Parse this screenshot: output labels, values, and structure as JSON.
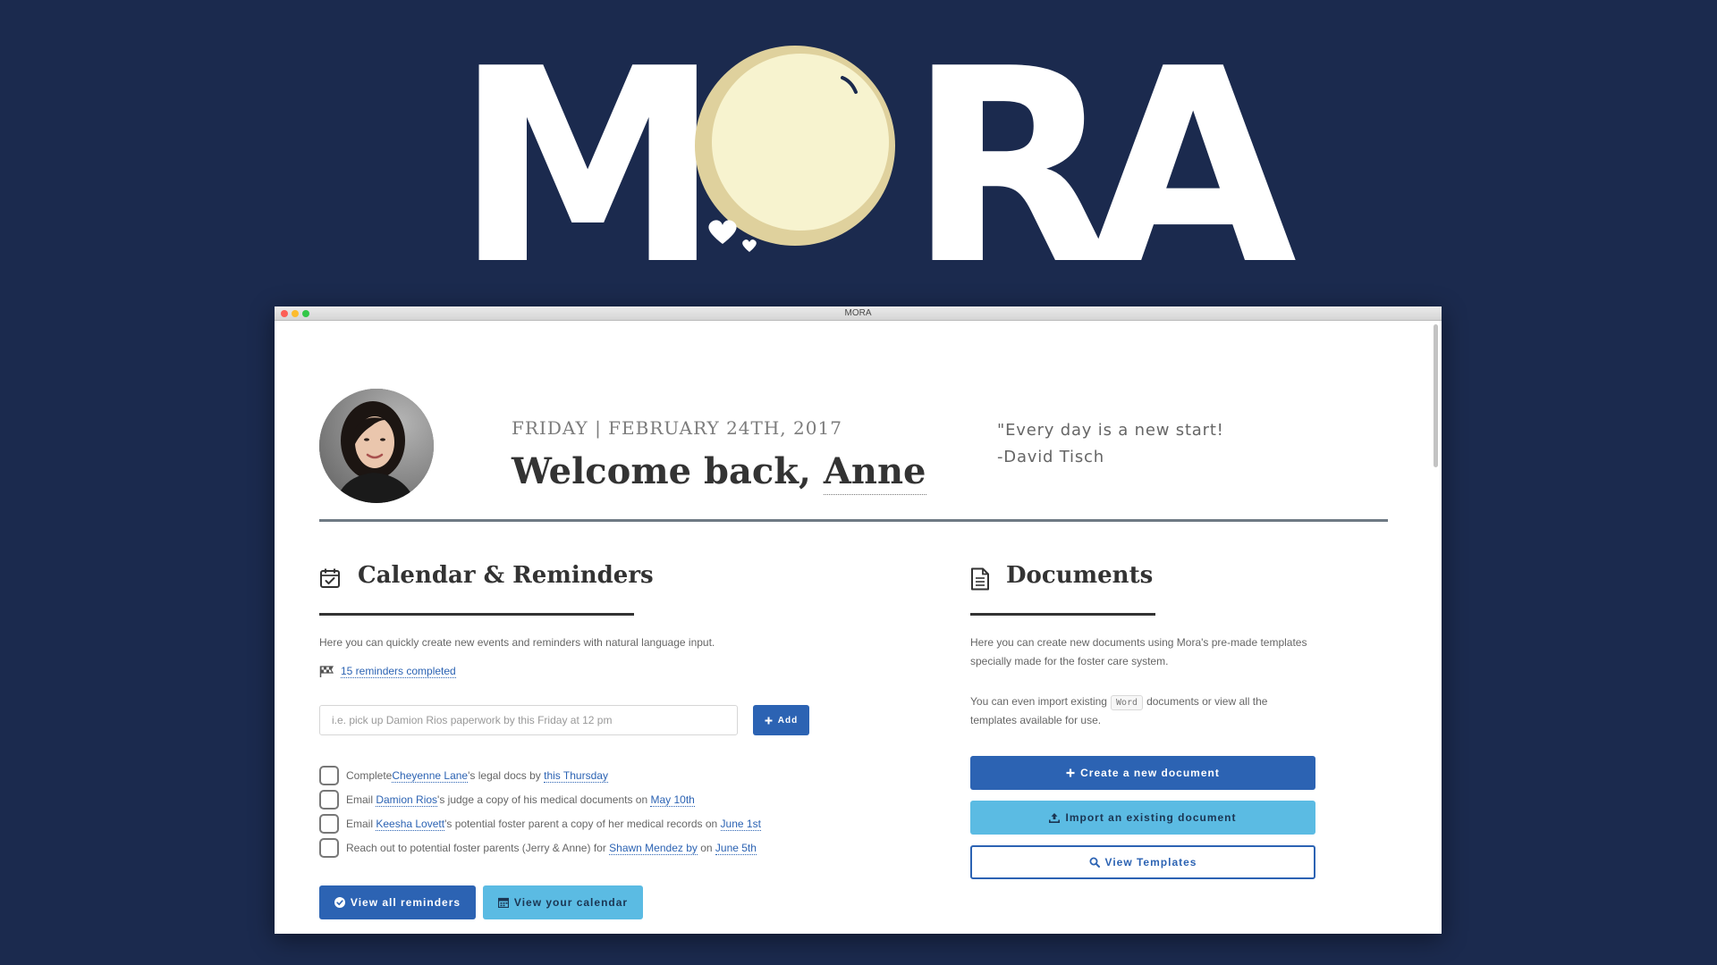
{
  "logo": {
    "letters": [
      "M",
      "R",
      "A"
    ]
  },
  "window": {
    "title": "MORA"
  },
  "header": {
    "date": "FRIDAY | FEBRUARY 24TH, 2017",
    "welcome_prefix": "Welcome back, ",
    "user_name": "Anne",
    "quote_line1": "\"Every day is a new start!",
    "quote_line2": "-David Tisch"
  },
  "calendar": {
    "title": "Calendar & Reminders",
    "description": "Here you can quickly create new events and reminders with natural language input.",
    "completed_link": "15 reminders completed",
    "input_placeholder": "i.e. pick up Damion Rios paperwork by this Friday at 12 pm",
    "add_label": "Add",
    "reminders": [
      {
        "before": "Complete ",
        "person": "Cheyenne Lane",
        "middle": "'s legal docs by ",
        "date": "this Thursday"
      },
      {
        "before": "Email ",
        "person": "Damion Rios",
        "middle": "'s judge a copy of his medical documents on ",
        "date": "May 10th"
      },
      {
        "before": "Email ",
        "person": "Keesha Lovett",
        "middle": "'s potential foster parent a copy of her medical records on ",
        "date": "June 1st"
      },
      {
        "before": "Reach out to potential foster parents (Jerry & Anne) for ",
        "person": "Shawn Mendez by",
        "middle": " on ",
        "date": "June 5th"
      }
    ],
    "view_reminders_label": "View all reminders",
    "view_calendar_label": "View your calendar"
  },
  "documents": {
    "title": "Documents",
    "description_line1": "Here you can create new documents using Mora's pre-made templates",
    "description_line2": "specially made for the foster care system.",
    "import_text_before": "You can even import existing",
    "word_tag": "Word",
    "import_text_after": "documents or view all the",
    "import_text_line2": "templates available for use.",
    "create_label": "Create a new document",
    "import_label": "Import an existing document",
    "templates_label": "View Templates"
  },
  "colors": {
    "background": "#1b2a4e",
    "primary": "#2c63b3",
    "secondary": "#5bbbe3",
    "moon": "#f7f3cf",
    "moon_rim": "#dfd19d"
  }
}
